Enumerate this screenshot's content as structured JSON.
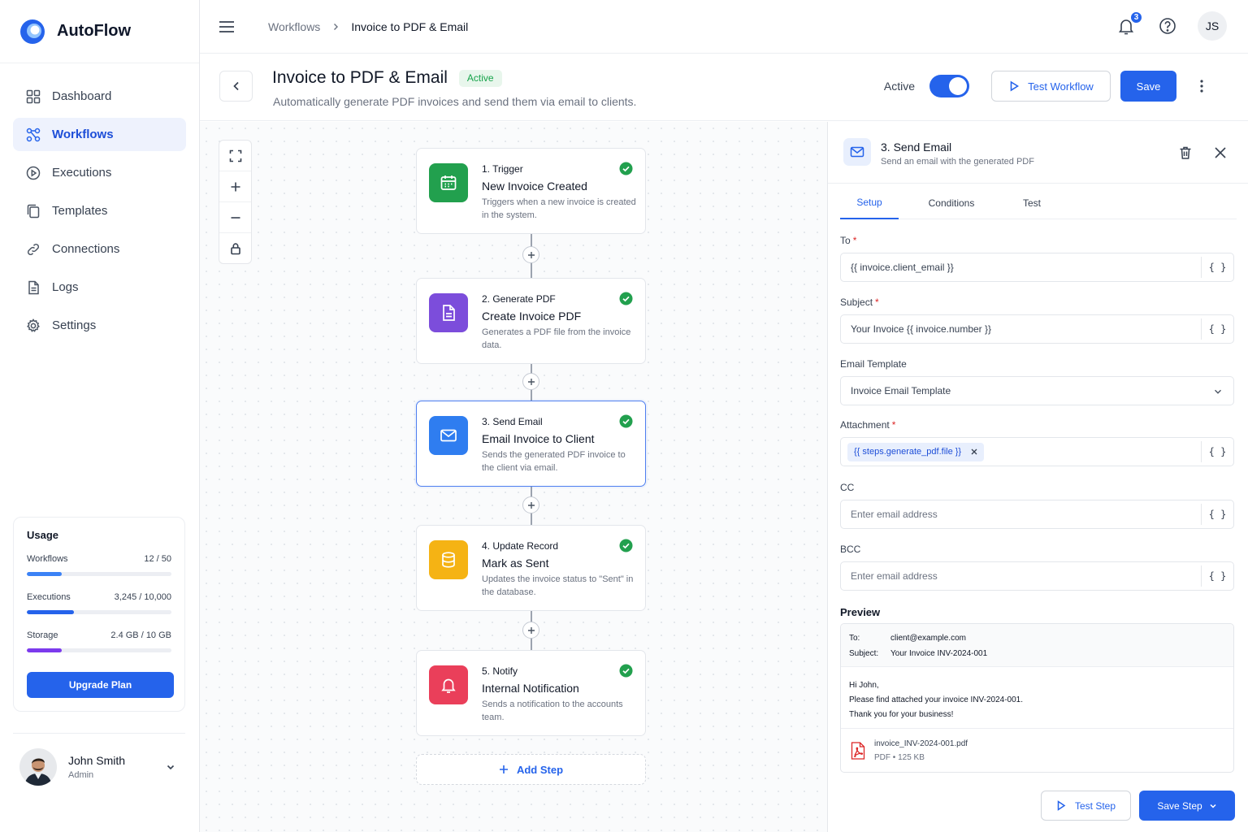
{
  "brand": {
    "name": "AutoFlow"
  },
  "sidebar": {
    "items": [
      {
        "label": "Dashboard",
        "icon": "grid-icon"
      },
      {
        "label": "Workflows",
        "icon": "workflow-icon",
        "active": true
      },
      {
        "label": "Executions",
        "icon": "play-circle-icon"
      },
      {
        "label": "Templates",
        "icon": "copy-icon"
      },
      {
        "label": "Connections",
        "icon": "link-icon"
      },
      {
        "label": "Logs",
        "icon": "document-icon"
      },
      {
        "label": "Settings",
        "icon": "gear-icon"
      }
    ]
  },
  "usage": {
    "title": "Usage",
    "metrics": [
      {
        "label": "Workflows",
        "value": "12 / 50",
        "fraction": 0.24,
        "color": "#3b82f6"
      },
      {
        "label": "Executions",
        "value": "3,245 / 10,000",
        "fraction": 0.3245,
        "color": "#2563eb"
      },
      {
        "label": "Storage",
        "value": "2.4 GB / 10 GB",
        "fraction": 0.24,
        "color": "#7c3aed"
      }
    ],
    "upgrade_label": "Upgrade Plan"
  },
  "user": {
    "name": "John Smith",
    "role": "Admin",
    "initials": "JS"
  },
  "topbar": {
    "breadcrumb": {
      "parent": "Workflows",
      "current": "Invoice to PDF & Email"
    },
    "notification_count": "3"
  },
  "header": {
    "title": "Invoice to PDF & Email",
    "status": "Active",
    "subtitle": "Automatically generate PDF invoices and send them via email to clients.",
    "active_label": "Active",
    "active_on": true,
    "test_label": "Test Workflow",
    "save_label": "Save"
  },
  "workflow": {
    "nodes": [
      {
        "step": "1. Trigger",
        "title": "New Invoice Created",
        "desc": "Triggers when a new invoice is created in the system.",
        "icon": "calendar-icon",
        "color": "#22a04e"
      },
      {
        "step": "2. Generate PDF",
        "title": "Create Invoice PDF",
        "desc": "Generates a PDF file from the invoice data.",
        "icon": "file-icon",
        "color": "#7c4ddb"
      },
      {
        "step": "3. Send Email",
        "title": "Email Invoice to Client",
        "desc": "Sends the generated PDF invoice to the client via email.",
        "icon": "mail-icon",
        "color": "#2f7df0",
        "selected": true
      },
      {
        "step": "4. Update Record",
        "title": "Mark as Sent",
        "desc": "Updates the invoice status to \"Sent\" in the database.",
        "icon": "database-icon",
        "color": "#f5b314"
      },
      {
        "step": "5. Notify",
        "title": "Internal Notification",
        "desc": "Sends a notification to the accounts team.",
        "icon": "bell-icon",
        "color": "#ea3f5a"
      }
    ],
    "add_step_label": "Add Step"
  },
  "panel": {
    "title": "3. Send Email",
    "subtitle": "Send an email with the generated PDF",
    "tabs": [
      "Setup",
      "Conditions",
      "Test"
    ],
    "fields": {
      "to_label": "To",
      "to_value": "{{ invoice.client_email }}",
      "subject_label": "Subject",
      "subject_value": "Your Invoice {{ invoice.number }}",
      "template_label": "Email Template",
      "template_value": "Invoice Email Template",
      "attachment_label": "Attachment",
      "attachment_chip": "{{ steps.generate_pdf.file }}",
      "cc_label": "CC",
      "cc_placeholder": "Enter email address",
      "bcc_label": "BCC",
      "bcc_placeholder": "Enter email address",
      "var_symbol": "{ }",
      "required_mark": "*"
    },
    "preview": {
      "title": "Preview",
      "to_key": "To:",
      "to_value": "client@example.com",
      "subject_key": "Subject:",
      "subject_value": "Your Invoice INV-2024-001",
      "line1": "Hi John,",
      "line2": "Please find attached your invoice INV-2024-001.",
      "line3": "Thank you for your business!",
      "file_name": "invoice_INV-2024-001.pdf",
      "file_type": "PDF",
      "file_size": "125 KB",
      "meta_sep": "•"
    },
    "test_step_label": "Test Step",
    "save_step_label": "Save Step"
  }
}
